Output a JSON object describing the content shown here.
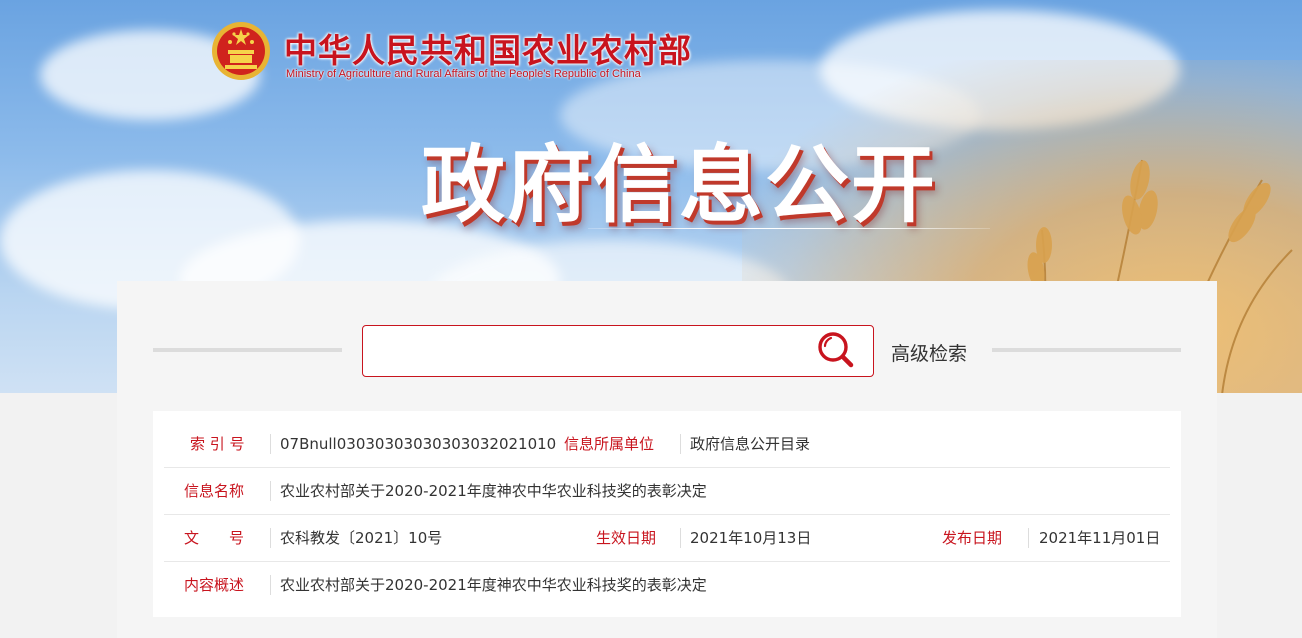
{
  "header": {
    "site_title": "中华人民共和国农业农村部",
    "site_subtitle": "Ministry of Agriculture and Rural Affairs of the People's Republic of China",
    "hero_title": "政府信息公开",
    "emblem_icon": "national-emblem-icon"
  },
  "search": {
    "placeholder": "",
    "value": "",
    "search_icon": "search-icon",
    "advanced_label": "高级检索"
  },
  "info": {
    "index_label": "索 引 号",
    "index_value": "07Bnull03030303030303032021010",
    "unit_label": "信息所属单位",
    "unit_value": "政府信息公开目录",
    "name_label": "信息名称",
    "name_value": "农业农村部关于2020-2021年度神农中华农业科技奖的表彰决定",
    "docno_label": "文　　号",
    "docno_value": "农科教发〔2021〕10号",
    "effective_label": "生效日期",
    "effective_value": "2021年10月13日",
    "publish_label": "发布日期",
    "publish_value": "2021年11月01日",
    "summary_label": "内容概述",
    "summary_value": "农业农村部关于2020-2021年度神农中华农业科技奖的表彰决定"
  },
  "colors": {
    "brand_red": "#c8141e",
    "sky_blue": "#6aa3e1",
    "wheat_gold": "#e2aa5f"
  }
}
